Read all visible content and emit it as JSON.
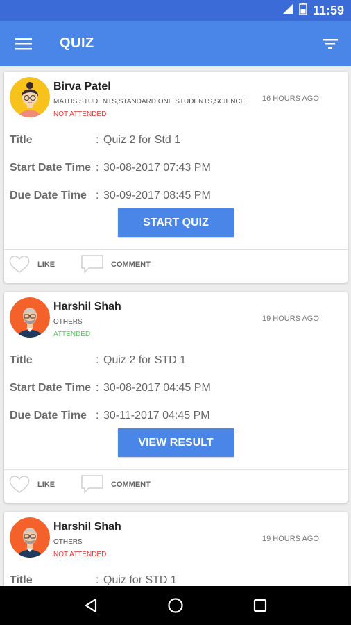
{
  "status_bar": {
    "time": "11:59"
  },
  "app_bar": {
    "title": "QUIZ"
  },
  "quizzes": [
    {
      "author": "Birva Patel",
      "audience": "MATHS STUDENTS,STANDARD ONE STUDENTS,SCIENCE",
      "status": "NOT ATTENDED",
      "time_ago": "16 HOURS AGO",
      "fields": [
        {
          "label": "Title",
          "value": "Quiz 2 for Std 1"
        },
        {
          "label": "Start Date Time",
          "value": "30-08-2017 07:43 PM"
        },
        {
          "label": "Due Date Time",
          "value": "30-09-2017 08:45 PM"
        }
      ],
      "button_label": "START QUIZ",
      "like_label": "LIKE",
      "comment_label": "COMMENT"
    },
    {
      "author": "Harshil Shah",
      "audience": "OTHERS",
      "status": "ATTENDED",
      "time_ago": "19 HOURS AGO",
      "fields": [
        {
          "label": "Title",
          "value": "Quiz 2 for STD 1"
        },
        {
          "label": "Start Date Time",
          "value": "30-08-2017 04:45 PM"
        },
        {
          "label": "Due Date Time",
          "value": "30-11-2017 04:45 PM"
        }
      ],
      "button_label": "VIEW RESULT",
      "like_label": "LIKE",
      "comment_label": "COMMENT"
    },
    {
      "author": "Harshil Shah",
      "audience": "OTHERS",
      "status": "NOT ATTENDED",
      "time_ago": "19 HOURS AGO",
      "fields": [
        {
          "label": "Title",
          "value": "Quiz for STD 1"
        }
      ]
    }
  ],
  "separator": ":",
  "colors": {
    "primary": "#4a86e8",
    "status_bar": "#3a6bd6",
    "not_attended": "#e53935",
    "attended": "#43d049"
  },
  "icons": [
    "hamburger-menu-icon",
    "filter-icon",
    "heart-icon",
    "comment-icon",
    "back-icon",
    "home-icon",
    "recents-icon",
    "wifi-icon",
    "battery-icon"
  ]
}
